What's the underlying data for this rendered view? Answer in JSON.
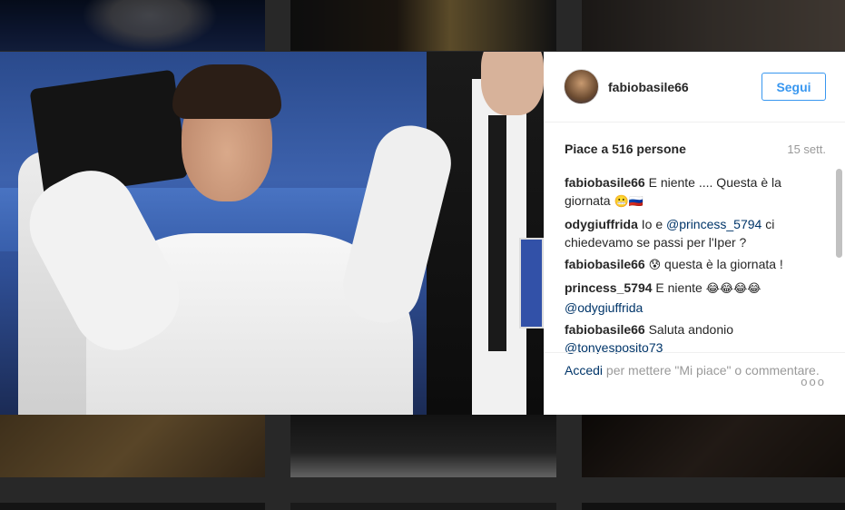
{
  "post": {
    "username": "fabiobasile66",
    "follow_label": "Segui",
    "likes_text": "Piace a 516 persone",
    "time_ago": "15 sett."
  },
  "comments": [
    {
      "user": "fabiobasile66",
      "text": "E niente .... Questa è la giornata",
      "emoji": "😬🇷🇺"
    },
    {
      "user": "odygiuffrida",
      "pre": "Io e",
      "mention": "@princess_5794",
      "post": "ci chiedevamo se passi per l'Iper ?"
    },
    {
      "user": "fabiobasile66",
      "emoji": "😰",
      "text": "questa è la giornata !"
    },
    {
      "user": "princess_5794",
      "text": "E niente",
      "emoji": "😂😂😂😂",
      "mention": "@odygiuffrida"
    },
    {
      "user": "fabiobasile66",
      "text": "Saluta andonio",
      "mention": "@tonyesposito73"
    }
  ],
  "footer": {
    "login_label": "Accedi",
    "prompt_text": "per mettere \"Mi piace\" o commentare.",
    "more_icon": "ooo"
  }
}
